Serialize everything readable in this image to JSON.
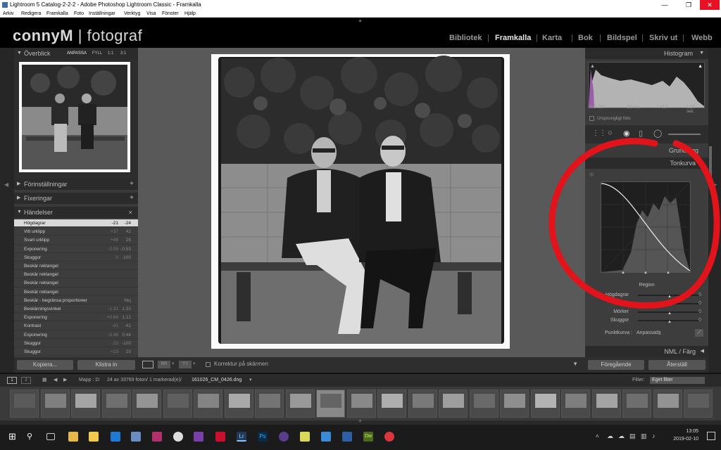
{
  "window": {
    "title": "Lightroom 5 Catalog-2-2-2 - Adobe Photoshop Lightroom Classic - Framkalla"
  },
  "menu": [
    "Arkiv",
    "Redigera",
    "Framkalla",
    "Foto",
    "Inställningar",
    "Verktyg",
    "Visa",
    "Fönster",
    "Hjälp"
  ],
  "brand": {
    "name": "connyM",
    "suffix": "fotograf"
  },
  "modules": [
    {
      "label": "Bibliotek",
      "active": false
    },
    {
      "label": "Framkalla",
      "active": true
    },
    {
      "label": "Karta",
      "active": false
    },
    {
      "label": "Bok",
      "active": false
    },
    {
      "label": "Bildspel",
      "active": false
    },
    {
      "label": "Skriv ut",
      "active": false
    },
    {
      "label": "Webb",
      "active": false
    }
  ],
  "left": {
    "navigator": {
      "title": "Överblick",
      "zoom": [
        "ANPASSA",
        "FYLL",
        "1:1",
        "3:1"
      ]
    },
    "presets": "Förinställningar",
    "snapshots": "Fixeringar",
    "history": {
      "title": "Händelser",
      "close": "×",
      "items": [
        {
          "label": "Högdagrar",
          "a": "-21",
          "b": "-24",
          "selected": true
        },
        {
          "label": "Vitt urklipp",
          "a": "+37",
          "b": "42"
        },
        {
          "label": "Svart urklipp",
          "a": "+48",
          "b": "28"
        },
        {
          "label": "Exponering",
          "a": "-0.59",
          "b": "-0.53"
        },
        {
          "label": "Skuggor",
          "a": "0",
          "b": "-100"
        },
        {
          "label": "Beskär rektangel",
          "a": "",
          "b": ""
        },
        {
          "label": "Beskär rektangel",
          "a": "",
          "b": ""
        },
        {
          "label": "Beskär rektangel",
          "a": "",
          "b": ""
        },
        {
          "label": "Beskär rektangel",
          "a": "",
          "b": ""
        },
        {
          "label": "Beskär - begränsa proportioner",
          "a": "",
          "b": "Nej"
        },
        {
          "label": "Beskärningsvinkel",
          "a": "-1.31",
          "b": "1.33"
        },
        {
          "label": "Exponering",
          "a": "+0.68",
          "b": "1.12"
        },
        {
          "label": "Kontrast",
          "a": "-41",
          "b": "-41"
        },
        {
          "label": "Exponering",
          "a": "-0.48",
          "b": "0.44"
        },
        {
          "label": "Skuggor",
          "a": "-22",
          "b": "-100"
        },
        {
          "label": "Skuggor",
          "a": "+23",
          "b": "23"
        }
      ]
    },
    "buttons": {
      "copy": "Kopiera...",
      "paste": "Klistra in"
    }
  },
  "right": {
    "histogram": {
      "title": "Histogram",
      "iso": "ISO 200",
      "focal": "56 mm",
      "aperture": "f / 8,0",
      "shutter": "1/20 sek.",
      "original": "Ursprungligt foto"
    },
    "basic": "Grundlägg",
    "tonecurve": {
      "title": "Tonkurva",
      "region": "Region",
      "sliders": [
        {
          "label": "Högdagrar",
          "value": "0"
        },
        {
          "label": "Ljus",
          "value": "0"
        },
        {
          "label": "Mörker",
          "value": "0"
        },
        {
          "label": "Skuggor",
          "value": "0"
        }
      ],
      "pointcurve_label": "Punktkurva :",
      "pointcurve_value": "Anpassad"
    },
    "hsl": "NML / Färg",
    "buttons": {
      "prev": "Föregående",
      "reset": "Återställ"
    }
  },
  "toolbar": {
    "softproof": "Korrektur på skärmen"
  },
  "filmstrip": {
    "source": "Mapp : D:",
    "info": "24 av 33769 foton/ 1 markerad(e)/",
    "file": "161026_CM_0426.dng",
    "filter_label": "Filter:",
    "filter_value": "Eget filter",
    "count": 23,
    "selected": 10
  },
  "taskbar": {
    "time": "13:05",
    "date": "2019-02-10"
  }
}
